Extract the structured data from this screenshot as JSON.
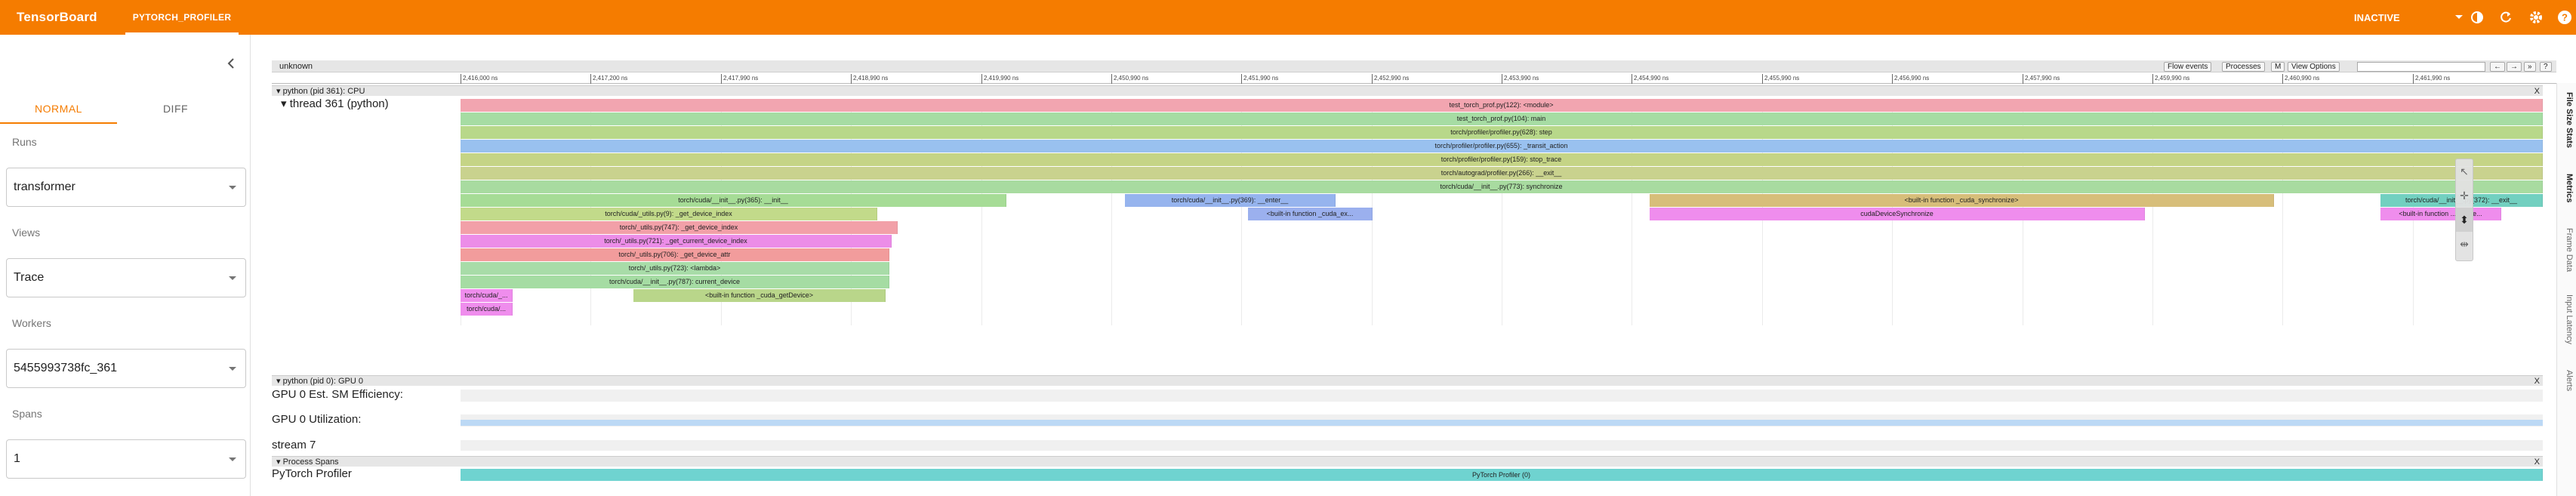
{
  "header": {
    "brand": "TensorBoard",
    "plugin_tab": "PYTORCH_PROFILER",
    "status": "INACTIVE",
    "icons": [
      "theme-toggle-icon",
      "refresh-icon",
      "settings-icon",
      "help-icon"
    ]
  },
  "sidebar": {
    "mode_tabs": [
      {
        "label": "NORMAL",
        "active": true
      },
      {
        "label": "DIFF",
        "active": false
      }
    ],
    "fields": [
      {
        "label": "Runs",
        "value": "transformer"
      },
      {
        "label": "Views",
        "value": "Trace"
      },
      {
        "label": "Workers",
        "value": "5455993738fc_361"
      },
      {
        "label": "Spans",
        "value": "1"
      }
    ]
  },
  "trace": {
    "title": "unknown",
    "toolbar": {
      "flow_events": "Flow events",
      "processes": "Processes",
      "m": "M",
      "view_options": "View Options",
      "nav_left": "←",
      "nav_right": "→",
      "nav_fwd": "»",
      "help": "?"
    },
    "ruler_ticks": [
      "2,416,000 ns",
      "2,417,200 ns",
      "2,417,990 ns",
      "2,418,990 ns",
      "2,419,990 ns",
      "2,450,990 ns",
      "2,451,990 ns",
      "2,452,990 ns",
      "2,453,990 ns",
      "2,454,990 ns",
      "2,455,990 ns",
      "2,456,990 ns",
      "2,457,990 ns",
      "2,459,990 ns",
      "2,460,990 ns",
      "2,461,990 ns"
    ],
    "cpu_process": "python (pid 361): CPU",
    "thread_label": "thread 361 (python)",
    "slices": [
      {
        "row": 0,
        "start": 0.0,
        "end": 1.0,
        "label": "test_torch_prof.py(122): <module>",
        "color": "#f2a5b0"
      },
      {
        "row": 1,
        "start": 0.0,
        "end": 1.0,
        "label": "test_torch_prof.py(104): main",
        "color": "#a6dca3"
      },
      {
        "row": 2,
        "start": 0.0,
        "end": 1.0,
        "label": "torch/profiler/profiler.py(628): step",
        "color": "#b8d88a"
      },
      {
        "row": 3,
        "start": 0.0,
        "end": 1.0,
        "label": "torch/profiler/profiler.py(655): _transit_action",
        "color": "#99c1ef"
      },
      {
        "row": 4,
        "start": 0.0,
        "end": 1.0,
        "label": "torch/profiler/profiler.py(159): stop_trace",
        "color": "#c5d486"
      },
      {
        "row": 5,
        "start": 0.0,
        "end": 1.0,
        "label": "torch/autograd/profiler.py(266): __exit__",
        "color": "#c9d28e"
      },
      {
        "row": 6,
        "start": 0.0,
        "end": 1.0,
        "label": "torch/cuda/__init__.py(773): synchronize",
        "color": "#a8dba0"
      },
      {
        "row": 7,
        "start": 0.0,
        "end": 0.262,
        "label": "torch/cuda/__init__.py(365): __init__",
        "color": "#a6dc96"
      },
      {
        "row": 7,
        "start": 0.319,
        "end": 0.42,
        "label": "torch/cuda/__init__.py(369): __enter__",
        "color": "#96b4ee"
      },
      {
        "row": 7,
        "start": 0.571,
        "end": 0.871,
        "label": "<built-in function _cuda_synchronize>",
        "color": "#d7be7a"
      },
      {
        "row": 7,
        "start": 0.922,
        "end": 1.0,
        "label": "torch/cuda/__init__.py(372): __exit__",
        "color": "#72d0c0"
      },
      {
        "row": 8,
        "start": 0.0,
        "end": 0.2,
        "label": "torch/cuda/_utils.py(9): _get_device_index",
        "color": "#c2da8a"
      },
      {
        "row": 8,
        "start": 0.378,
        "end": 0.438,
        "label": "<built-in function _cuda_ex...",
        "color": "#9bb0ee"
      },
      {
        "row": 8,
        "start": 0.571,
        "end": 0.809,
        "label": "cudaDeviceSynchronize",
        "color": "#ef8ded"
      },
      {
        "row": 8,
        "start": 0.922,
        "end": 0.98,
        "label": "<built-in function ...maybe...",
        "color": "#ef8ded"
      },
      {
        "row": 9,
        "start": 0.0,
        "end": 0.21,
        "label": "torch/_utils.py(747): _get_device_index",
        "color": "#f2a0a8"
      },
      {
        "row": 10,
        "start": 0.0,
        "end": 0.207,
        "label": "torch/_utils.py(721): _get_current_device_index",
        "color": "#ec8de8"
      },
      {
        "row": 11,
        "start": 0.0,
        "end": 0.206,
        "label": "torch/_utils.py(706): _get_device_attr",
        "color": "#f29c9c"
      },
      {
        "row": 12,
        "start": 0.0,
        "end": 0.206,
        "label": "torch/_utils.py(723): <lambda>",
        "color": "#a8dca8"
      },
      {
        "row": 13,
        "start": 0.0,
        "end": 0.206,
        "label": "torch/cuda/__init__.py(787): current_device",
        "color": "#a5dca3"
      },
      {
        "row": 14,
        "start": 0.0,
        "end": 0.025,
        "label": "torch/cuda/_...",
        "color": "#ef8ded"
      },
      {
        "row": 14,
        "start": 0.083,
        "end": 0.204,
        "label": "<built-in function _cuda_getDevice>",
        "color": "#b9d68a"
      },
      {
        "row": 15,
        "start": 0.0,
        "end": 0.025,
        "label": "torch/cuda/...",
        "color": "#ef8ded"
      }
    ],
    "gpu_process": "python (pid 0): GPU 0",
    "gpu_tracks": [
      {
        "label": "GPU 0 Est. SM Efficiency:"
      },
      {
        "label": "GPU 0 Utilization:"
      },
      {
        "label": "stream 7"
      }
    ],
    "spans_process": "Process Spans",
    "spans_track": "PyTorch Profiler",
    "spans_slice": {
      "label": "PyTorch Profiler (0)",
      "color": "#6fd3d0"
    },
    "close_x": "X",
    "side_tabs": [
      {
        "label": "File Size Stats",
        "active": true
      },
      {
        "label": "Metrics",
        "active": true
      },
      {
        "label": "Frame Data",
        "active": false
      },
      {
        "label": "Input Latency",
        "active": false
      },
      {
        "label": "Alerts",
        "active": false
      }
    ]
  },
  "colors": {
    "header": "#f57c00",
    "accent": "#f57c00",
    "gpu_util": "#bcd9f5"
  }
}
